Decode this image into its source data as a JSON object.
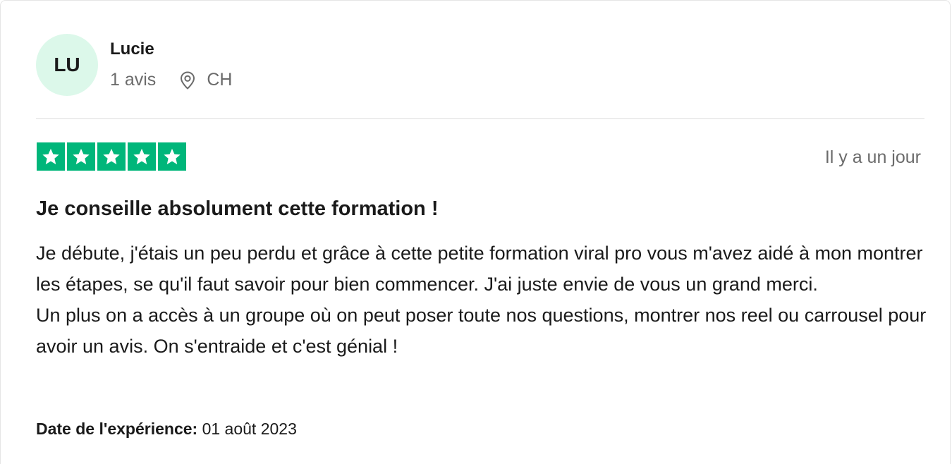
{
  "reviewer": {
    "initials": "LU",
    "name": "Lucie",
    "review_count": "1 avis",
    "location": "CH",
    "location_icon": "location-pin-icon"
  },
  "review": {
    "rating": 5,
    "rating_max": 5,
    "star_color": "#00b67a",
    "relative_date": "Il y a un jour",
    "title": "Je conseille absolument cette formation !",
    "body_lines": [
      "Je débute, j'étais un peu perdu et grâce à cette petite formation viral pro vous m'avez aidé à mon montrer les étapes, se qu'il faut savoir pour bien commencer. J'ai juste envie de vous un grand merci.",
      "Un plus on a accès à un groupe où on peut poser toute nos questions, montrer nos reel ou carrousel pour avoir un avis. On s'entraide et c'est génial !"
    ],
    "experience_label": "Date de l'expérience:",
    "experience_date": "01 août 2023"
  },
  "colors": {
    "avatar_bg": "#dcf8ea",
    "muted_text": "#6b6b6b"
  }
}
